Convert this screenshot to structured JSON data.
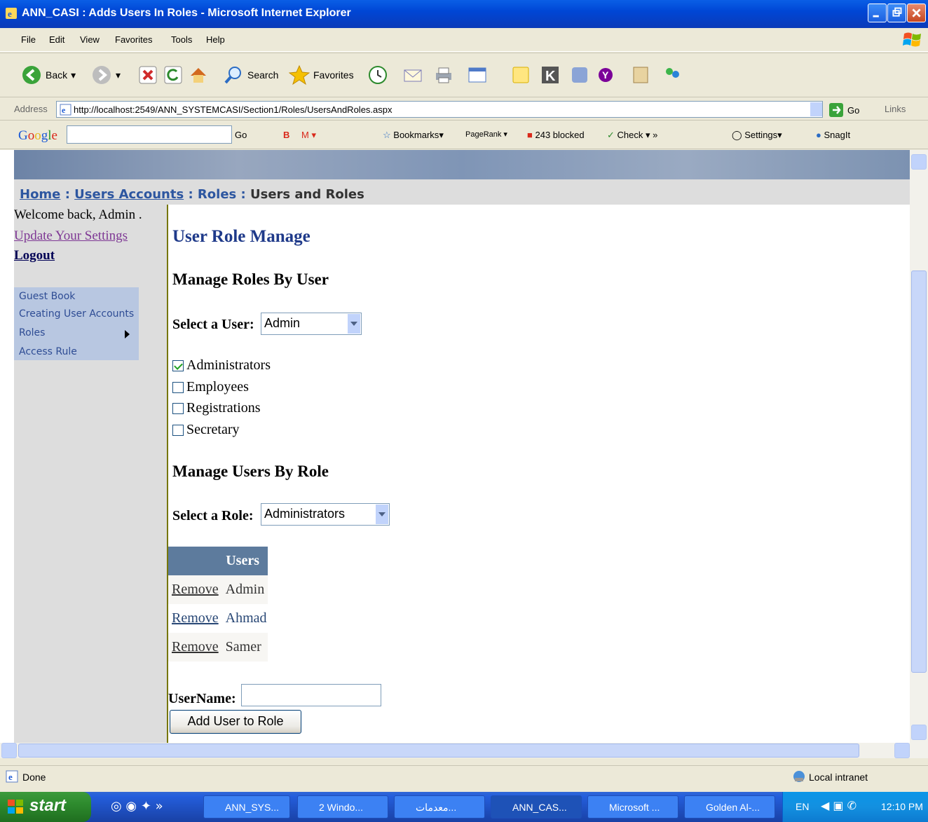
{
  "window": {
    "title": "ANN_CASI : Adds Users In Roles - Microsoft Internet Explorer"
  },
  "menu": [
    "File",
    "Edit",
    "View",
    "Favorites",
    "Tools",
    "Help"
  ],
  "toolbar": {
    "back": "Back",
    "search": "Search",
    "favorites": "Favorites"
  },
  "address": {
    "label": "Address",
    "url": "http://localhost:2549/ANN_SYSTEMCASI/Section1/Roles/UsersAndRoles.aspx",
    "go": "Go",
    "links": "Links"
  },
  "google": {
    "go": "Go",
    "bookmarks": "Bookmarks",
    "pagerank": "PageRank",
    "blocked": "243 blocked",
    "check": "Check",
    "settings": "Settings",
    "snagit": "SnagIt"
  },
  "breadcrumb": {
    "home": "Home",
    "sep": ":",
    "users_accounts": "Users Accounts",
    "roles": "Roles",
    "current": "Users and Roles"
  },
  "sidebar": {
    "welcome": "Welcome back, Admin .",
    "update": "Update Your Settings",
    "logout": "Logout",
    "menu": [
      "Guest Book",
      "Creating User Accounts",
      "Roles",
      "Access Rule"
    ]
  },
  "main": {
    "title": "User Role Manage",
    "by_user_heading": "Manage Roles By User",
    "select_user_label": "Select a User:",
    "selected_user": "Admin",
    "roles": [
      {
        "label": "Administrators",
        "checked": true
      },
      {
        "label": "Employees",
        "checked": false
      },
      {
        "label": "Registrations",
        "checked": false
      },
      {
        "label": "Secretary",
        "checked": false
      }
    ],
    "by_role_heading": "Manage Users By Role",
    "select_role_label": "Select a Role:",
    "selected_role": "Administrators",
    "users_header": "Users",
    "users": [
      {
        "action": "Remove",
        "name": "Admin"
      },
      {
        "action": "Remove",
        "name": "Ahmad"
      },
      {
        "action": "Remove",
        "name": "Samer"
      }
    ],
    "username_label": "UserName:",
    "username_value": "",
    "add_button": "Add User to Role"
  },
  "status": {
    "text": "Done",
    "zone": "Local intranet"
  },
  "taskbar": {
    "start": "start",
    "tasks": [
      "ANN_SYS...",
      "2 Windo...",
      "ﻣﻌﺪﻣﺎﺕ...",
      "ANN_CAS...",
      "Microsoft ...",
      "Golden Al-..."
    ],
    "lang": "EN",
    "clock": "12:10 PM"
  },
  "colors": {
    "titlebar": "#0A5FE6",
    "heading": "#1F3A8A",
    "table_header": "#5D7B9D",
    "start": "#2E8B2E"
  }
}
